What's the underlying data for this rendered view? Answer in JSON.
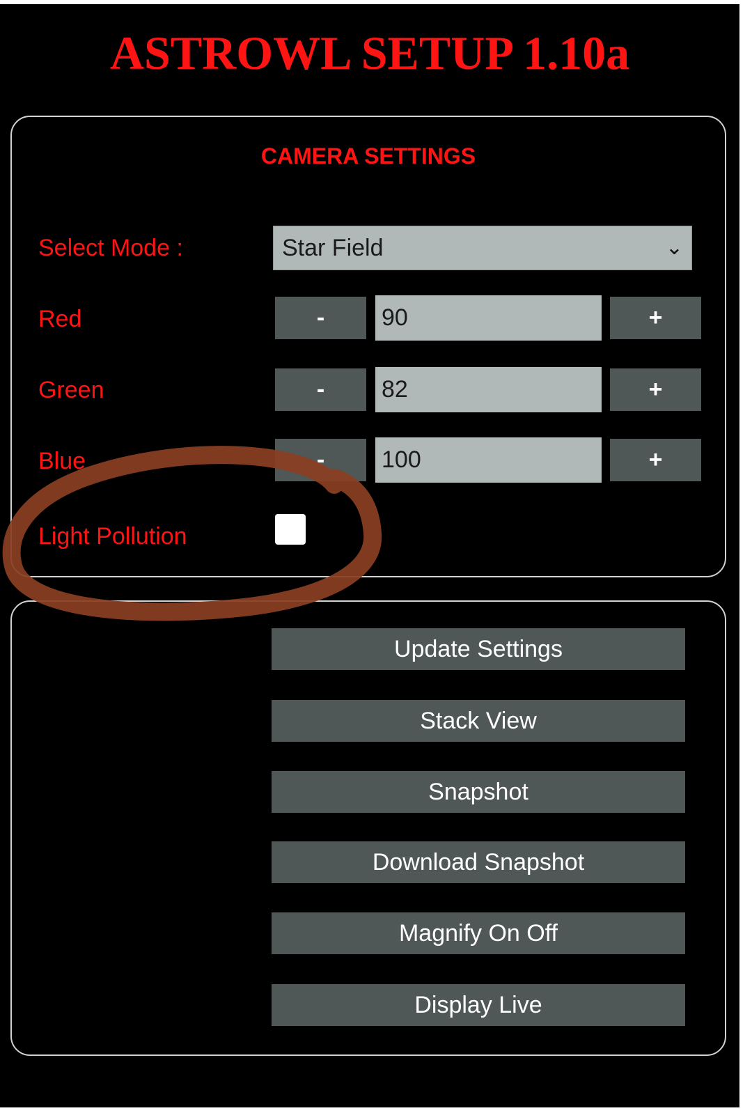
{
  "app": {
    "title": "ASTROWL SETUP 1.10a"
  },
  "camera_settings": {
    "section_title": "CAMERA SETTINGS",
    "mode": {
      "label": "Select Mode :",
      "selected": "Star Field"
    },
    "channels": [
      {
        "label": "Red",
        "value": "90",
        "decrement_label": "-",
        "increment_label": "+"
      },
      {
        "label": "Green",
        "value": "82",
        "decrement_label": "-",
        "increment_label": "+"
      },
      {
        "label": "Blue",
        "value": "100",
        "decrement_label": "-",
        "increment_label": "+"
      }
    ],
    "light_pollution": {
      "label": "Light Pollution",
      "checked": false
    }
  },
  "actions": [
    {
      "label": "Update Settings"
    },
    {
      "label": "Stack View"
    },
    {
      "label": "Snapshot"
    },
    {
      "label": "Download Snapshot"
    },
    {
      "label": "Magnify On Off"
    },
    {
      "label": "Display Live"
    }
  ],
  "colors": {
    "background": "#000000",
    "label_red": "#ff1414",
    "button_gray": "#4f5757",
    "field_gray": "#b1b8b8",
    "panel_border": "#d2d2d2",
    "annotation_brown": "#8a3e22"
  },
  "icons": {
    "select_chevron": "chevron-down-icon"
  }
}
